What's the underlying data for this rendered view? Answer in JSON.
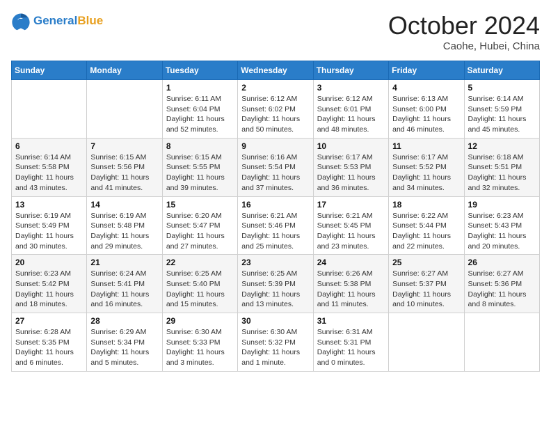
{
  "header": {
    "logo_general": "General",
    "logo_blue": "Blue",
    "month_title": "October 2024",
    "location": "Caohe, Hubei, China"
  },
  "weekdays": [
    "Sunday",
    "Monday",
    "Tuesday",
    "Wednesday",
    "Thursday",
    "Friday",
    "Saturday"
  ],
  "weeks": [
    [
      {
        "day": "",
        "sunrise": "",
        "sunset": "",
        "daylight": ""
      },
      {
        "day": "",
        "sunrise": "",
        "sunset": "",
        "daylight": ""
      },
      {
        "day": "1",
        "sunrise": "Sunrise: 6:11 AM",
        "sunset": "Sunset: 6:04 PM",
        "daylight": "Daylight: 11 hours and 52 minutes."
      },
      {
        "day": "2",
        "sunrise": "Sunrise: 6:12 AM",
        "sunset": "Sunset: 6:02 PM",
        "daylight": "Daylight: 11 hours and 50 minutes."
      },
      {
        "day": "3",
        "sunrise": "Sunrise: 6:12 AM",
        "sunset": "Sunset: 6:01 PM",
        "daylight": "Daylight: 11 hours and 48 minutes."
      },
      {
        "day": "4",
        "sunrise": "Sunrise: 6:13 AM",
        "sunset": "Sunset: 6:00 PM",
        "daylight": "Daylight: 11 hours and 46 minutes."
      },
      {
        "day": "5",
        "sunrise": "Sunrise: 6:14 AM",
        "sunset": "Sunset: 5:59 PM",
        "daylight": "Daylight: 11 hours and 45 minutes."
      }
    ],
    [
      {
        "day": "6",
        "sunrise": "Sunrise: 6:14 AM",
        "sunset": "Sunset: 5:58 PM",
        "daylight": "Daylight: 11 hours and 43 minutes."
      },
      {
        "day": "7",
        "sunrise": "Sunrise: 6:15 AM",
        "sunset": "Sunset: 5:56 PM",
        "daylight": "Daylight: 11 hours and 41 minutes."
      },
      {
        "day": "8",
        "sunrise": "Sunrise: 6:15 AM",
        "sunset": "Sunset: 5:55 PM",
        "daylight": "Daylight: 11 hours and 39 minutes."
      },
      {
        "day": "9",
        "sunrise": "Sunrise: 6:16 AM",
        "sunset": "Sunset: 5:54 PM",
        "daylight": "Daylight: 11 hours and 37 minutes."
      },
      {
        "day": "10",
        "sunrise": "Sunrise: 6:17 AM",
        "sunset": "Sunset: 5:53 PM",
        "daylight": "Daylight: 11 hours and 36 minutes."
      },
      {
        "day": "11",
        "sunrise": "Sunrise: 6:17 AM",
        "sunset": "Sunset: 5:52 PM",
        "daylight": "Daylight: 11 hours and 34 minutes."
      },
      {
        "day": "12",
        "sunrise": "Sunrise: 6:18 AM",
        "sunset": "Sunset: 5:51 PM",
        "daylight": "Daylight: 11 hours and 32 minutes."
      }
    ],
    [
      {
        "day": "13",
        "sunrise": "Sunrise: 6:19 AM",
        "sunset": "Sunset: 5:49 PM",
        "daylight": "Daylight: 11 hours and 30 minutes."
      },
      {
        "day": "14",
        "sunrise": "Sunrise: 6:19 AM",
        "sunset": "Sunset: 5:48 PM",
        "daylight": "Daylight: 11 hours and 29 minutes."
      },
      {
        "day": "15",
        "sunrise": "Sunrise: 6:20 AM",
        "sunset": "Sunset: 5:47 PM",
        "daylight": "Daylight: 11 hours and 27 minutes."
      },
      {
        "day": "16",
        "sunrise": "Sunrise: 6:21 AM",
        "sunset": "Sunset: 5:46 PM",
        "daylight": "Daylight: 11 hours and 25 minutes."
      },
      {
        "day": "17",
        "sunrise": "Sunrise: 6:21 AM",
        "sunset": "Sunset: 5:45 PM",
        "daylight": "Daylight: 11 hours and 23 minutes."
      },
      {
        "day": "18",
        "sunrise": "Sunrise: 6:22 AM",
        "sunset": "Sunset: 5:44 PM",
        "daylight": "Daylight: 11 hours and 22 minutes."
      },
      {
        "day": "19",
        "sunrise": "Sunrise: 6:23 AM",
        "sunset": "Sunset: 5:43 PM",
        "daylight": "Daylight: 11 hours and 20 minutes."
      }
    ],
    [
      {
        "day": "20",
        "sunrise": "Sunrise: 6:23 AM",
        "sunset": "Sunset: 5:42 PM",
        "daylight": "Daylight: 11 hours and 18 minutes."
      },
      {
        "day": "21",
        "sunrise": "Sunrise: 6:24 AM",
        "sunset": "Sunset: 5:41 PM",
        "daylight": "Daylight: 11 hours and 16 minutes."
      },
      {
        "day": "22",
        "sunrise": "Sunrise: 6:25 AM",
        "sunset": "Sunset: 5:40 PM",
        "daylight": "Daylight: 11 hours and 15 minutes."
      },
      {
        "day": "23",
        "sunrise": "Sunrise: 6:25 AM",
        "sunset": "Sunset: 5:39 PM",
        "daylight": "Daylight: 11 hours and 13 minutes."
      },
      {
        "day": "24",
        "sunrise": "Sunrise: 6:26 AM",
        "sunset": "Sunset: 5:38 PM",
        "daylight": "Daylight: 11 hours and 11 minutes."
      },
      {
        "day": "25",
        "sunrise": "Sunrise: 6:27 AM",
        "sunset": "Sunset: 5:37 PM",
        "daylight": "Daylight: 11 hours and 10 minutes."
      },
      {
        "day": "26",
        "sunrise": "Sunrise: 6:27 AM",
        "sunset": "Sunset: 5:36 PM",
        "daylight": "Daylight: 11 hours and 8 minutes."
      }
    ],
    [
      {
        "day": "27",
        "sunrise": "Sunrise: 6:28 AM",
        "sunset": "Sunset: 5:35 PM",
        "daylight": "Daylight: 11 hours and 6 minutes."
      },
      {
        "day": "28",
        "sunrise": "Sunrise: 6:29 AM",
        "sunset": "Sunset: 5:34 PM",
        "daylight": "Daylight: 11 hours and 5 minutes."
      },
      {
        "day": "29",
        "sunrise": "Sunrise: 6:30 AM",
        "sunset": "Sunset: 5:33 PM",
        "daylight": "Daylight: 11 hours and 3 minutes."
      },
      {
        "day": "30",
        "sunrise": "Sunrise: 6:30 AM",
        "sunset": "Sunset: 5:32 PM",
        "daylight": "Daylight: 11 hours and 1 minute."
      },
      {
        "day": "31",
        "sunrise": "Sunrise: 6:31 AM",
        "sunset": "Sunset: 5:31 PM",
        "daylight": "Daylight: 11 hours and 0 minutes."
      },
      {
        "day": "",
        "sunrise": "",
        "sunset": "",
        "daylight": ""
      },
      {
        "day": "",
        "sunrise": "",
        "sunset": "",
        "daylight": ""
      }
    ]
  ]
}
